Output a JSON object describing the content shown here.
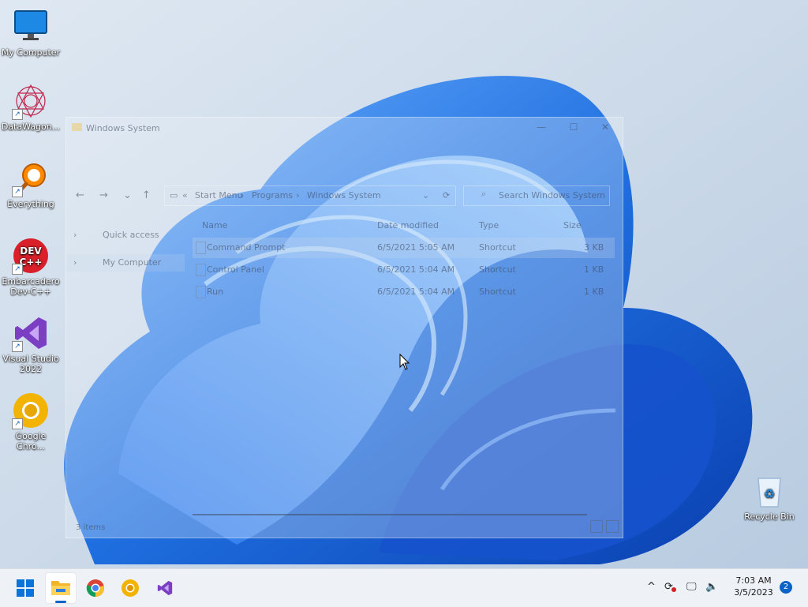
{
  "desktop": {
    "icons": [
      {
        "label": "My Computer",
        "icon": "monitor-icon"
      },
      {
        "label": "DataWagon...",
        "icon": "datawagon-icon"
      },
      {
        "label": "Everything",
        "icon": "everything-search-icon"
      },
      {
        "label": "Embarcadero Dev-C++",
        "icon": "devcpp-icon",
        "badge": "DEV C++"
      },
      {
        "label": "Visual Studio 2022",
        "icon": "visual-studio-icon"
      },
      {
        "label": "Google Chro...",
        "icon": "chrome-canary-icon"
      },
      {
        "label": "Recycle Bin",
        "icon": "recycle-bin-icon"
      }
    ]
  },
  "explorer": {
    "title": "Windows System",
    "controls": {
      "minimize": "—",
      "maximize": "☐",
      "close": "✕"
    },
    "nav": {
      "back": "←",
      "forward": "→",
      "recent": "⌄",
      "up": "↑"
    },
    "address": {
      "sep": "«",
      "parts": [
        "Start Menu",
        "Programs",
        "Windows System"
      ],
      "arrow": "›"
    },
    "search_placeholder": "Search Windows System",
    "sidebar": [
      {
        "label": "Quick access"
      },
      {
        "label": "My Computer"
      }
    ],
    "columns": [
      "Name",
      "Date modified",
      "Type",
      "Size"
    ],
    "files": [
      {
        "name": "Command Prompt",
        "date": "6/5/2021 5:05 AM",
        "type": "Shortcut",
        "size": "3 KB"
      },
      {
        "name": "Control Panel",
        "date": "6/5/2021 5:04 AM",
        "type": "Shortcut",
        "size": "1 KB"
      },
      {
        "name": "Run",
        "date": "6/5/2021 5:04 AM",
        "type": "Shortcut",
        "size": "1 KB"
      }
    ],
    "status": "3 items"
  },
  "taskbar": {
    "apps": [
      {
        "name": "start",
        "icon": "windows-start-icon"
      },
      {
        "name": "file-explorer",
        "icon": "file-explorer-icon",
        "active": true
      },
      {
        "name": "chrome",
        "icon": "chrome-icon"
      },
      {
        "name": "chrome-canary",
        "icon": "chrome-canary-icon"
      },
      {
        "name": "visual-studio",
        "icon": "visual-studio-icon"
      }
    ],
    "tray": {
      "chevron": "^"
    },
    "clock": {
      "time": "7:03 AM",
      "date": "3/5/2023"
    },
    "notifications": "2"
  },
  "colors": {
    "accent": "#0a64c8",
    "wallpaper_blue": "#1f6fe0",
    "taskbar": "#eef1f5"
  }
}
